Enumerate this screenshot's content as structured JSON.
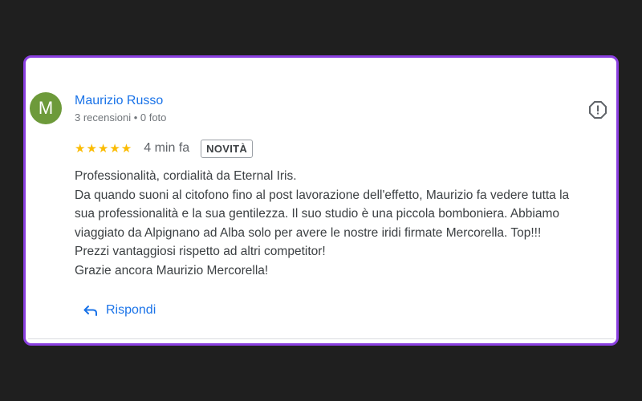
{
  "review": {
    "author_initial": "M",
    "author_name": "Maurizio Russo",
    "author_meta": "3 recensioni • 0 foto",
    "stars": "★★★★★",
    "rating": 5,
    "time_ago": "4 min fa",
    "badge": "NOVITÀ",
    "body_lines": [
      "Professionalità, cordialità da Eternal Iris.",
      "Da quando suoni al citofono fino al post lavorazione dell'effetto, Maurizio fa vedere tutta la",
      "sua professionalità e la sua gentilezza. Il suo studio è una piccola bomboniera. Abbiamo",
      "viaggiato da Alpignano ad Alba solo per avere le nostre iridi firmate Mercorella. Top!!!",
      "Prezzi vantaggiosi rispetto ad altri competitor!",
      "Grazie ancora Maurizio Mercorella!"
    ],
    "reply_label": "Rispondi"
  },
  "icons": {
    "flag": "report-flag-icon",
    "reply": "reply-arrow-icon"
  },
  "colors": {
    "background": "#1f1f1f",
    "card_border": "#8a3fe0",
    "avatar": "#6d9a3a",
    "link": "#1a73e8",
    "star": "#fbbc04"
  }
}
